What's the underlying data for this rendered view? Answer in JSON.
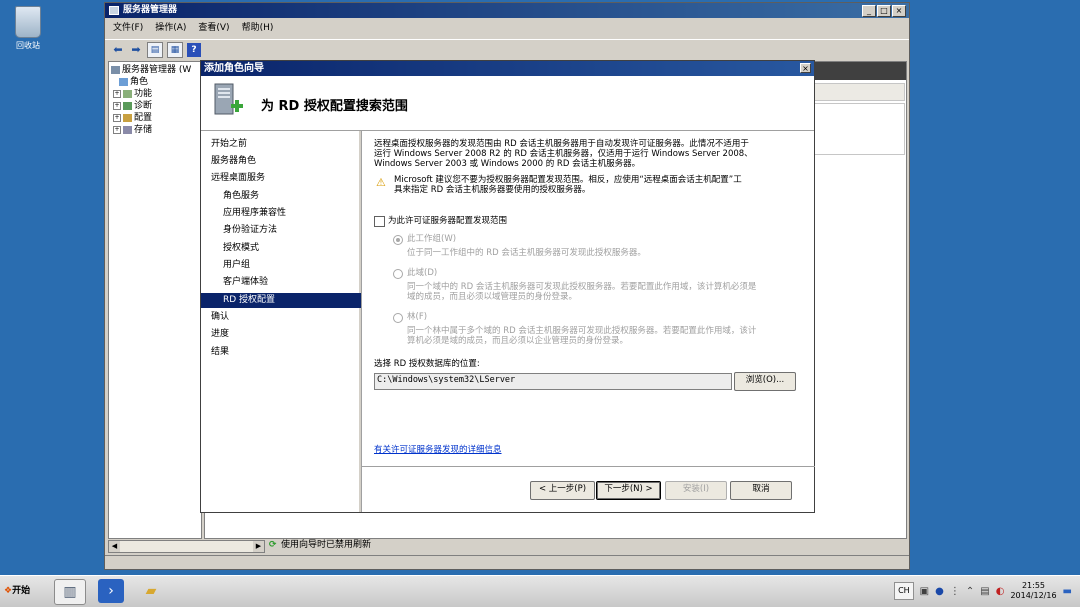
{
  "desktop": {
    "recycle_bin_label": "回收站"
  },
  "window": {
    "title": "服务器管理器",
    "controls": {
      "minimize": "_",
      "maximize": "□",
      "close": "×"
    },
    "menu": [
      "文件(F)",
      "操作(A)",
      "查看(V)",
      "帮助(H)"
    ],
    "tree": {
      "root": "服务器管理器 (W",
      "items": [
        "角色",
        "功能",
        "诊断",
        "配置",
        "存储"
      ]
    },
    "status_text": "使用向导时已禁用刷新"
  },
  "wizard": {
    "title": "添加角色向导",
    "close": "×",
    "heading": "为 RD 授权配置搜索范围",
    "steps": [
      "开始之前",
      "服务器角色",
      "远程桌面服务",
      "角色服务",
      "应用程序兼容性",
      "身份验证方法",
      "授权模式",
      "用户组",
      "客户端体验",
      "RD 授权配置",
      "确认",
      "进度",
      "结果"
    ],
    "selected_step": 9,
    "intro_line1": "远程桌面授权服务器的发现范围由 RD 会话主机服务器用于自动发现许可证服务器。此情况不适用于",
    "intro_line2": "运行 Windows Server 2008 R2 的 RD 会话主机服务器，仅适用于运行 Windows Server 2008、",
    "intro_line3": "Windows Server 2003 或 Windows 2000 的 RD 会话主机服务器。",
    "warning_line1": "Microsoft 建议您不要为授权服务器配置发现范围。相反，应使用“远程桌面会话主机配置”工",
    "warning_line2": "具来指定 RD 会话主机服务器要使用的授权服务器。",
    "checkbox_label": "为此许可证服务器配置发现范围",
    "options": [
      {
        "label": "此工作组(W)",
        "desc1": "位于同一工作组中的 RD 会话主机服务器可发现此授权服务器。",
        "desc2": ""
      },
      {
        "label": "此域(D)",
        "desc1": "同一个域中的 RD 会话主机服务器可发现此授权服务器。若要配置此作用域，该计算机必须是",
        "desc2": "域的成员，而且必须以域管理员的身份登录。"
      },
      {
        "label": "林(F)",
        "desc1": "同一个林中属于多个域的 RD 会话主机服务器可发现此授权服务器。若要配置此作用域，该计",
        "desc2": "算机必须是域的成员，而且必须以企业管理员的身份登录。"
      }
    ],
    "db_location_label": "选择 RD 授权数据库的位置:",
    "db_location_value": "C:\\Windows\\system32\\LServer",
    "browse_button": "浏览(O)...",
    "more_info_link": "有关许可证服务器发现的详细信息",
    "buttons": {
      "back": "< 上一步(P)",
      "next": "下一步(N) >",
      "install": "安装(I)",
      "cancel": "取消"
    }
  },
  "taskbar": {
    "start_label": "开始",
    "language": "CH",
    "clock_time": "21:55",
    "clock_date": "2014/12/16"
  }
}
